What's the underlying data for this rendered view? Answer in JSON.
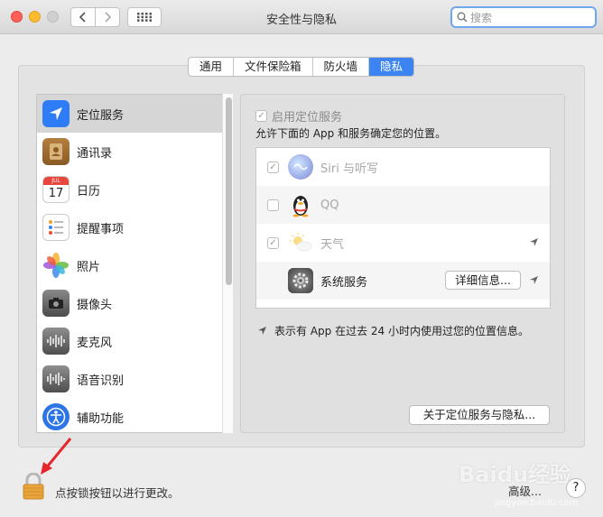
{
  "window": {
    "title": "安全性与隐私",
    "search_placeholder": "搜索"
  },
  "tabs": [
    {
      "label": "通用",
      "active": false
    },
    {
      "label": "文件保险箱",
      "active": false
    },
    {
      "label": "防火墙",
      "active": false
    },
    {
      "label": "隐私",
      "active": true
    }
  ],
  "sidebar": {
    "items": [
      {
        "label": "定位服务",
        "icon": "location-arrow-icon",
        "selected": true
      },
      {
        "label": "通讯录",
        "icon": "contacts-book-icon"
      },
      {
        "label": "日历",
        "icon": "calendar-icon",
        "badge_month": "JUL",
        "badge_day": "17"
      },
      {
        "label": "提醒事项",
        "icon": "reminders-list-icon"
      },
      {
        "label": "照片",
        "icon": "photos-flower-icon"
      },
      {
        "label": "摄像头",
        "icon": "camera-icon"
      },
      {
        "label": "麦克风",
        "icon": "microphone-waveform-icon"
      },
      {
        "label": "语音识别",
        "icon": "speech-waveform-icon"
      },
      {
        "label": "辅助功能",
        "icon": "accessibility-icon"
      }
    ]
  },
  "location": {
    "enable_label": "启用定位服务",
    "enabled": true,
    "description": "允许下面的 App 和服务确定您的位置。",
    "apps": [
      {
        "label": "Siri 与听写",
        "checked": true,
        "dim": true,
        "icon": "siri-icon",
        "recent": false
      },
      {
        "label": "QQ",
        "checked": false,
        "dim": true,
        "icon": "qq-penguin-icon",
        "recent": false
      },
      {
        "label": "天气",
        "checked": true,
        "dim": true,
        "icon": "weather-sun-icon",
        "recent": true
      },
      {
        "label": "系统服务",
        "checked": null,
        "dim": false,
        "icon": "system-gear-icon",
        "recent": true,
        "detail_button": "详细信息..."
      }
    ],
    "legend_text": "表示有 App 在过去 24 小时内使用过您的位置信息。",
    "about_button": "关于定位服务与隐私..."
  },
  "footer": {
    "lock_text": "点按锁按钮以进行更改。",
    "advanced_button": "高级...",
    "help_button": "?"
  },
  "watermark": {
    "text": "Baidu经验",
    "url": "jingyan.baidu.com"
  },
  "colors": {
    "accent": "#3c84f1",
    "lock": "#e9a53a",
    "annotation_arrow": "#e5262b"
  }
}
